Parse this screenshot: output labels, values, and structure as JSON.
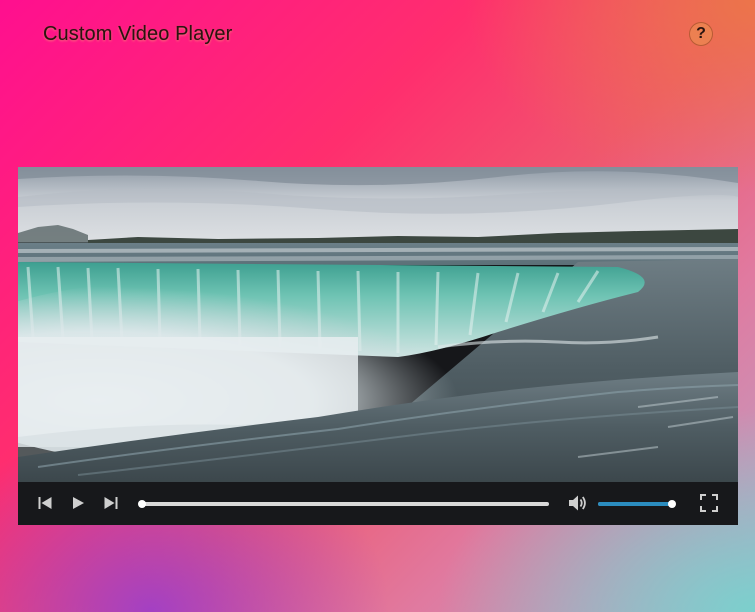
{
  "app": {
    "title": "Custom Video Player",
    "help_label": "?"
  },
  "player": {
    "progress": 0.0,
    "volume": 1.0,
    "controls": {
      "previous_icon": "skip-previous-icon",
      "play_icon": "play-icon",
      "next_icon": "skip-next-icon",
      "volume_icon": "volume-up-icon",
      "fullscreen_icon": "fullscreen-icon"
    },
    "colors": {
      "controls_bg": "#17181b",
      "volume_accent": "#2b8cbf",
      "progress_track": "#d9d9d9"
    }
  }
}
